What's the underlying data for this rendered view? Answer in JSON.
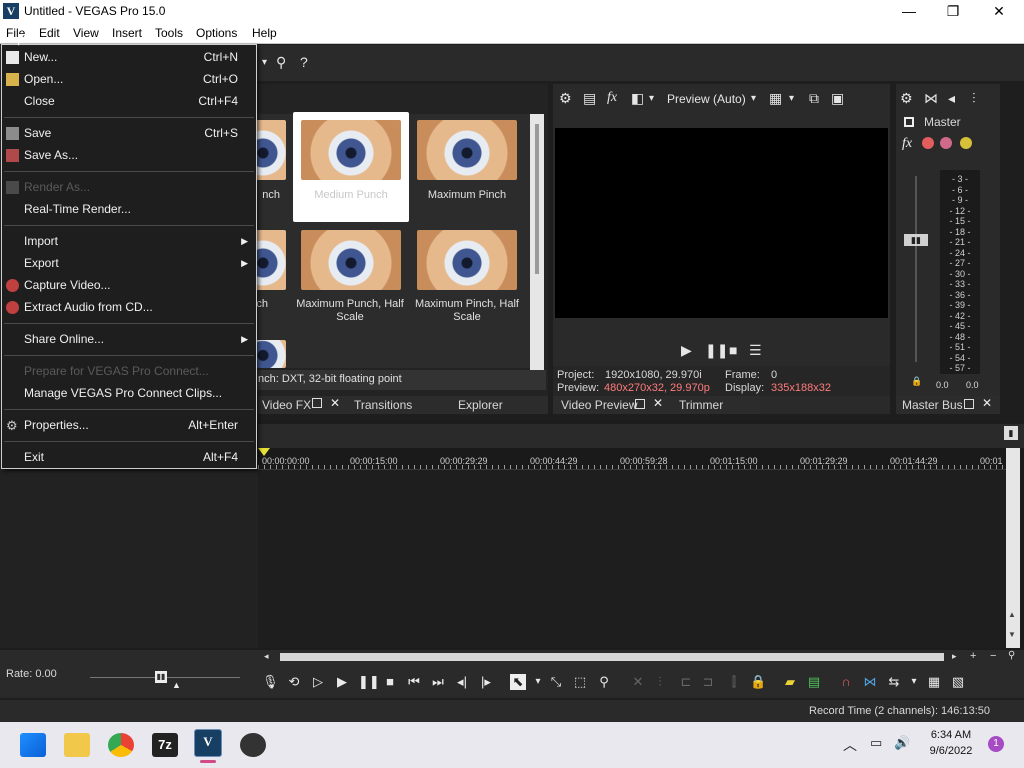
{
  "window": {
    "title": "Untitled - VEGAS Pro 15.0",
    "app_icon_letter": "V",
    "minimize": "—",
    "maximize": "❐",
    "close": "✕"
  },
  "menubar": [
    "File",
    "Edit",
    "View",
    "Insert",
    "Tools",
    "Options",
    "Help"
  ],
  "file_menu": {
    "new": {
      "label": "New...",
      "shortcut": "Ctrl+N"
    },
    "open": {
      "label": "Open...",
      "shortcut": "Ctrl+O"
    },
    "close": {
      "label": "Close",
      "shortcut": "Ctrl+F4"
    },
    "save": {
      "label": "Save",
      "shortcut": "Ctrl+S"
    },
    "save_as": {
      "label": "Save As..."
    },
    "render_as": {
      "label": "Render As..."
    },
    "realtime_render": {
      "label": "Real-Time Render..."
    },
    "import": {
      "label": "Import"
    },
    "export": {
      "label": "Export"
    },
    "capture_video": {
      "label": "Capture Video..."
    },
    "extract_audio": {
      "label": "Extract Audio from CD..."
    },
    "share_online": {
      "label": "Share Online..."
    },
    "prepare_connect": {
      "label": "Prepare for VEGAS Pro Connect..."
    },
    "manage_connect": {
      "label": "Manage VEGAS Pro Connect Clips..."
    },
    "properties": {
      "label": "Properties...",
      "shortcut": "Alt+Enter"
    },
    "exit": {
      "label": "Exit",
      "shortcut": "Alt+F4"
    }
  },
  "fx_browser": {
    "thumbs": [
      {
        "label": "nch"
      },
      {
        "label": "Medium Punch"
      },
      {
        "label": "Maximum Pinch"
      },
      {
        "label": "ch"
      },
      {
        "label": "Maximum Punch, Half Scale"
      },
      {
        "label": "Maximum Pinch, Half Scale"
      }
    ],
    "status": "nch: DXT, 32-bit floating point",
    "tabs": [
      "Video FX",
      "Transitions",
      "Explorer"
    ]
  },
  "preview": {
    "mode": "Preview (Auto)",
    "project_label": "Project:",
    "project_value": "1920x1080, 29.970i",
    "preview_label": "Preview:",
    "preview_value": "480x270x32, 29.970p",
    "frame_label": "Frame:",
    "frame_value": "0",
    "display_label": "Display:",
    "display_value": "335x188x32",
    "tabs": [
      "Video Preview",
      "Trimmer"
    ]
  },
  "master": {
    "title": "Master",
    "scale": [
      "3",
      "6",
      "9",
      "12",
      "15",
      "18",
      "21",
      "24",
      "27",
      "30",
      "33",
      "36",
      "39",
      "42",
      "45",
      "48",
      "51",
      "54",
      "57"
    ],
    "left_value": "0.0",
    "right_value": "0.0",
    "tab": "Master Bus"
  },
  "timeline": {
    "timecodes": [
      "00:00:00:00",
      "00:00:15:00",
      "00:00:29:29",
      "00:00:44:29",
      "00:00:59:28",
      "00:01:15:00",
      "00:01:29:29",
      "00:01:44:29",
      "00:01"
    ]
  },
  "rate_label": "Rate: 0.00",
  "status": {
    "record_time": "Record Time (2 channels): 146:13:50"
  },
  "taskbar": {
    "time": "6:34 AM",
    "date": "9/6/2022",
    "notification_count": "1",
    "sevenzip_label": "7z"
  },
  "colors": {
    "accent_red": "#ff7b7b",
    "panel": "#2a2a2a",
    "vegas_blue": "#173e63"
  }
}
